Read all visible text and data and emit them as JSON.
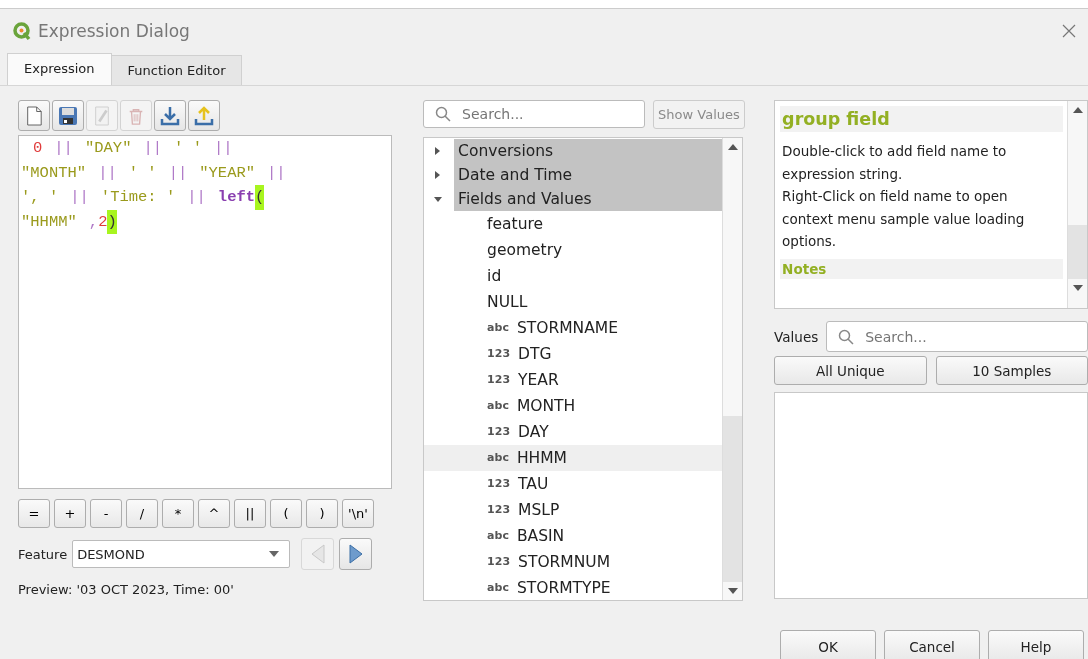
{
  "window": {
    "title": "Expression Dialog"
  },
  "tabs": [
    {
      "label": "Expression",
      "selected": true
    },
    {
      "label": "Function Editor",
      "selected": false
    }
  ],
  "toolbar": [
    {
      "kind": "new",
      "disabled": false
    },
    {
      "kind": "save",
      "disabled": false
    },
    {
      "kind": "edit",
      "disabled": true
    },
    {
      "kind": "delete",
      "disabled": true
    },
    {
      "kind": "import",
      "disabled": false
    },
    {
      "kind": "export",
      "disabled": false
    }
  ],
  "expression": {
    "lines": [
      [
        {
          "kind": "number",
          "text": "0"
        },
        {
          "kind": "operator",
          "text": "||"
        },
        {
          "kind": "field",
          "text": "\"DAY\""
        },
        {
          "kind": "operator",
          "text": "||"
        },
        {
          "kind": "string",
          "text": "' '"
        },
        {
          "kind": "operator",
          "text": "||"
        }
      ],
      [
        {
          "kind": "field",
          "text": "\"MONTH\""
        },
        {
          "kind": "operator",
          "text": "||"
        },
        {
          "kind": "string",
          "text": "' '"
        },
        {
          "kind": "operator",
          "text": "||"
        },
        {
          "kind": "field",
          "text": "\"YEAR\""
        },
        {
          "kind": "operator",
          "text": "||"
        }
      ],
      [
        {
          "kind": "string",
          "text": "', '"
        },
        {
          "kind": "operator",
          "text": "||"
        },
        {
          "kind": "string",
          "text": "'Time: '"
        },
        {
          "kind": "operator",
          "text": "||"
        },
        {
          "kind": "function",
          "text": "left"
        },
        {
          "kind": "bracket",
          "text": "("
        }
      ],
      [
        {
          "kind": "field",
          "text": "\"HHMM\""
        },
        {
          "kind": "operator",
          "text": ","
        },
        {
          "kind": "number",
          "text": "2"
        },
        {
          "kind": "bracket",
          "text": ")"
        }
      ]
    ]
  },
  "operators": [
    "=",
    "+",
    "-",
    "/",
    "*",
    "^",
    "||",
    "(",
    ")",
    "'\\n'"
  ],
  "feature": {
    "label": "Feature",
    "value": "DESMOND",
    "prev_disabled": true,
    "next_disabled": false
  },
  "preview": "Preview:  '03 OCT 2023, Time: 00'",
  "function_search": {
    "placeholder": "Search..."
  },
  "show_values": {
    "label": "Show Values",
    "disabled": true
  },
  "tree": [
    {
      "label": "Conversions",
      "expanded": false
    },
    {
      "label": "Date and Time",
      "expanded": false
    },
    {
      "label": "Fields and Values",
      "expanded": true,
      "children": [
        {
          "label": "feature",
          "selected": false
        },
        {
          "label": "geometry",
          "selected": false
        },
        {
          "label": "id",
          "selected": false
        },
        {
          "label": "NULL",
          "selected": false
        },
        {
          "badge": "abc",
          "label": "STORMNAME",
          "selected": false
        },
        {
          "badge": "123",
          "label": "DTG",
          "selected": false
        },
        {
          "badge": "123",
          "label": "YEAR",
          "selected": false
        },
        {
          "badge": "abc",
          "label": "MONTH",
          "selected": false
        },
        {
          "badge": "123",
          "label": "DAY",
          "selected": false
        },
        {
          "badge": "abc",
          "label": "HHMM",
          "selected": true
        },
        {
          "badge": "123",
          "label": "TAU",
          "selected": false
        },
        {
          "badge": "123",
          "label": "MSLP",
          "selected": false
        },
        {
          "badge": "abc",
          "label": "BASIN",
          "selected": false
        },
        {
          "badge": "123",
          "label": "STORMNUM",
          "selected": false
        },
        {
          "badge": "abc",
          "label": "STORMTYPE",
          "selected": false
        }
      ]
    }
  ],
  "help": {
    "title": "group field",
    "body": [
      "Double-click to add field name to expression string.",
      "Right-Click on field name to open context menu sample value loading options."
    ],
    "notes": "Notes"
  },
  "values": {
    "label": "Values",
    "placeholder": "Search...",
    "buttons": [
      "All Unique",
      "10 Samples"
    ]
  },
  "buttons": [
    "OK",
    "Cancel",
    "Help"
  ]
}
